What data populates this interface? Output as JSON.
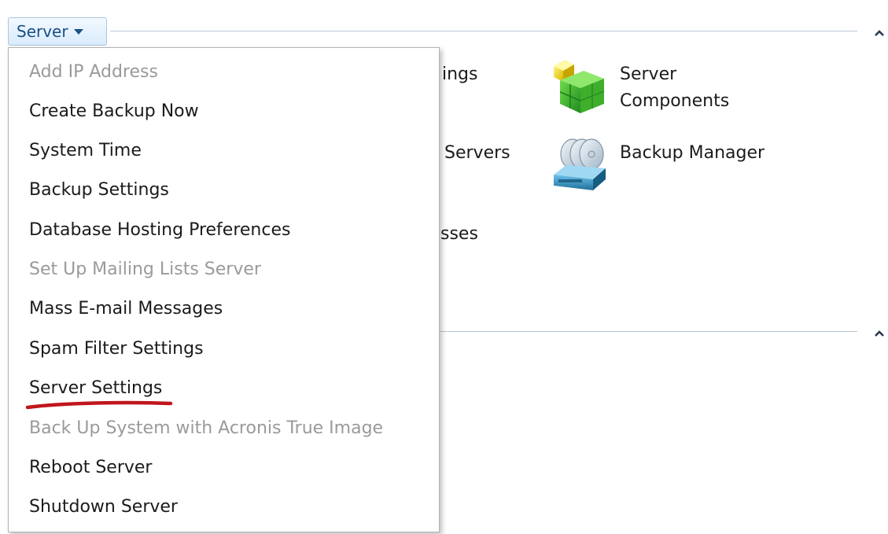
{
  "toolbar": {
    "server_label": "Server"
  },
  "background_items": {
    "settings_fragment": "ings",
    "servers_fragment": "Servers",
    "addresses_fragment": "sses",
    "server_components_line1": "Server",
    "server_components_line2": "Components",
    "backup_manager": "Backup Manager"
  },
  "menu": {
    "items": [
      {
        "label": "Add IP Address",
        "enabled": false
      },
      {
        "label": "Create Backup Now",
        "enabled": true
      },
      {
        "label": "System Time",
        "enabled": true
      },
      {
        "label": "Backup Settings",
        "enabled": true
      },
      {
        "label": "Database Hosting Preferences",
        "enabled": true
      },
      {
        "label": "Set Up Mailing Lists Server",
        "enabled": false
      },
      {
        "label": "Mass E-mail Messages",
        "enabled": true
      },
      {
        "label": "Spam Filter Settings",
        "enabled": true
      },
      {
        "label": "Server Settings",
        "enabled": true
      },
      {
        "label": "Back Up System with Acronis True Image",
        "enabled": false
      },
      {
        "label": "Reboot Server",
        "enabled": true
      },
      {
        "label": "Shutdown Server",
        "enabled": true
      }
    ]
  },
  "colors": {
    "highlight_underline": "#c0161c",
    "accent": "#1a4f86",
    "disabled_text": "#9a9a9a"
  },
  "icons": {
    "dropdown": "chevron-down-icon",
    "collapse": "chevron-up-icon",
    "components": "server-components-icon",
    "backup": "backup-manager-icon"
  }
}
